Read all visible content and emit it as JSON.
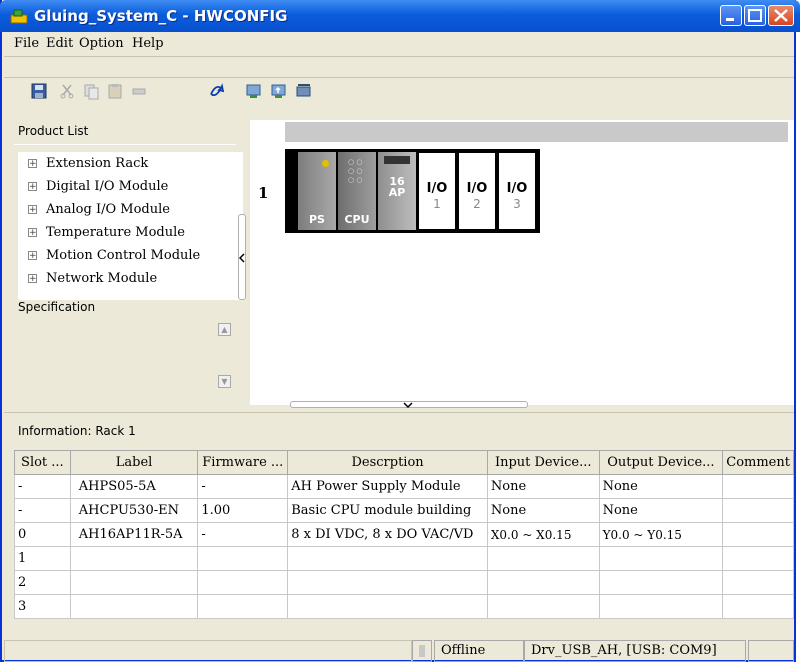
{
  "window": {
    "title": "Gluing_System_C - HWCONFIG"
  },
  "menu": [
    "File",
    "Edit",
    "Option",
    "Help"
  ],
  "toolbar": {
    "icons": [
      "save-icon",
      "cut-icon",
      "copy-icon",
      "paste-icon",
      "delete-icon",
      "refresh-icon",
      "download-icon",
      "upload-icon",
      "scan-icon"
    ]
  },
  "product_list": {
    "title": "Product List",
    "items": [
      "Extension Rack",
      "Digital I/O Module",
      "Analog I/O Module",
      "Temperature Module",
      "Motion Control Module",
      "Network Module"
    ]
  },
  "specification": {
    "title": "Specification"
  },
  "rack": {
    "number": "1",
    "slots": [
      {
        "label": "PS"
      },
      {
        "label": "CPU"
      },
      {
        "label": "16\nAP"
      },
      {
        "label": "I/O",
        "num": "1"
      },
      {
        "label": "I/O",
        "num": "2"
      },
      {
        "label": "I/O",
        "num": "3"
      }
    ]
  },
  "info": {
    "title": "Information: Rack 1"
  },
  "table": {
    "headers": [
      "Slot ...",
      "Label",
      "Firmware ...",
      "Descrption",
      "Input Device...",
      "Output Device...",
      "Comment"
    ],
    "rows": [
      [
        "-",
        "AHPS05-5A",
        "-",
        "AH Power Supply Module",
        "None",
        "None",
        ""
      ],
      [
        "-",
        "AHCPU530-EN",
        "1.00",
        "Basic CPU module building",
        "None",
        "None",
        ""
      ],
      [
        "0",
        "AH16AP11R-5A",
        "-",
        "8 x DI VDC, 8 x DO VAC/VD",
        "X0.0 ~ X0.15",
        "Y0.0 ~ Y0.15",
        ""
      ],
      [
        "1",
        "",
        "",
        "",
        "",
        "",
        ""
      ],
      [
        "2",
        "",
        "",
        "",
        "",
        "",
        ""
      ],
      [
        "3",
        "",
        "",
        "",
        "",
        "",
        ""
      ]
    ]
  },
  "status": {
    "mode": "Offline",
    "driver": "Drv_USB_AH, [USB: COM9]"
  }
}
